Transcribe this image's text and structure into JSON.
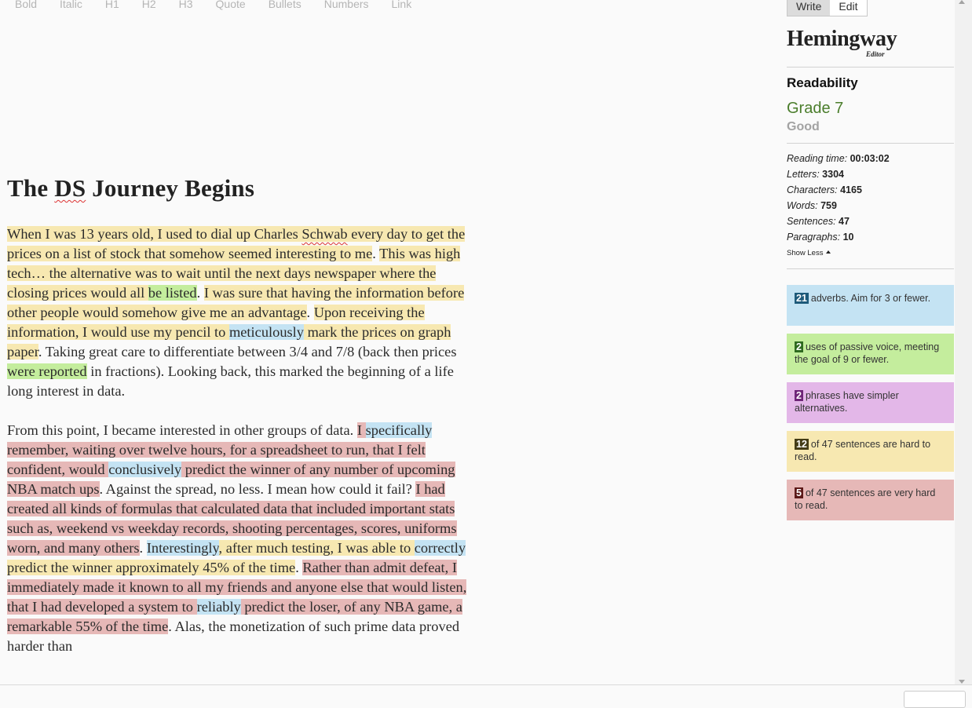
{
  "toolbar": {
    "bold": "Bold",
    "italic": "Italic",
    "h1": "H1",
    "h2": "H2",
    "h3": "H3",
    "quote": "Quote",
    "bullets": "Bullets",
    "numbers": "Numbers",
    "link": "Link"
  },
  "mode": {
    "write": "Write",
    "edit": "Edit",
    "active": "write"
  },
  "logo": {
    "name": "Hemingway",
    "sub": "Editor"
  },
  "readability": {
    "heading": "Readability",
    "grade": "Grade 7",
    "grade_desc": "Good"
  },
  "stats": {
    "reading_time_label": "Reading time:",
    "reading_time": "00:03:02",
    "letters_label": "Letters:",
    "letters": "3304",
    "characters_label": "Characters:",
    "characters": "4165",
    "words_label": "Words:",
    "words": "759",
    "sentences_label": "Sentences:",
    "sentences": "47",
    "paragraphs_label": "Paragraphs:",
    "paragraphs": "10",
    "show_less": "Show Less"
  },
  "cards": {
    "adverbs_count": "21",
    "adverbs_text": "adverbs. Aim for 3 or fewer.",
    "passive_count": "2",
    "passive_text": "uses of passive voice, meeting the goal of 9 or fewer.",
    "simpler_count": "2",
    "simpler_text": "phrases have simpler alternatives.",
    "hard_count": "12",
    "hard_text": "of 47 sentences are hard to read.",
    "very_hard_count": "5",
    "very_hard_text": "of 47 sentences are very hard to read."
  },
  "colors": {
    "hard_sentence": "#f7e8b1",
    "very_hard_sentence": "#e6b8b7",
    "adverb": "#c4e3f3",
    "passive": "#c4ed9d",
    "simpler": "#e3b7e8",
    "grade": "#4a7d2b"
  },
  "document": {
    "title_pre": "The ",
    "title_ds": "DS",
    "title_post": " Journey Begins",
    "p1": [
      {
        "t": "When I was 13 years old, I used to dial up Charles ",
        "h": "hy"
      },
      {
        "t": "Schwab",
        "h": "hy",
        "spell": true
      },
      {
        "t": " every day to get the prices on a list of stock that somehow seemed interesting to me",
        "h": "hy"
      },
      {
        "t": ". ",
        "h": ""
      },
      {
        "t": "This was high tech… the alternative was to wait until the next days newspaper where the closing prices would all ",
        "h": "hy"
      },
      {
        "t": "be listed",
        "h": "hg"
      },
      {
        "t": ". ",
        "h": ""
      },
      {
        "t": "I was sure that having the information before other people would somehow give me an advantage",
        "h": "hy"
      },
      {
        "t": ". ",
        "h": ""
      },
      {
        "t": "Upon receiving the information, I would use my pencil to ",
        "h": "hy"
      },
      {
        "t": "meticulously",
        "h": "hb"
      },
      {
        "t": " mark the prices on graph paper",
        "h": "hy"
      },
      {
        "t": ". Taking great care to differentiate between 3/4 and 7/8 (back then prices ",
        "h": ""
      },
      {
        "t": "were reported",
        "h": "hg"
      },
      {
        "t": " in fractions). Looking back, this marked the beginning of a life long interest in data.",
        "h": ""
      }
    ],
    "p2": [
      {
        "t": "From this point, I became interested in other groups of data. ",
        "h": ""
      },
      {
        "t": "I ",
        "h": "hr"
      },
      {
        "t": "specifically",
        "h": "hb"
      },
      {
        "t": " remember, waiting over twelve hours, for a spreadsheet to run, that I felt confident, would ",
        "h": "hr"
      },
      {
        "t": "conclusively",
        "h": "hb"
      },
      {
        "t": " predict the winner of any number of upcoming NBA match ups",
        "h": "hr"
      },
      {
        "t": ". Against the spread, no less. I mean how could it fail? ",
        "h": ""
      },
      {
        "t": "I had created all kinds of formulas that calculated data that included important stats such as, weekend vs weekday records, shooting percentages, scores, uniforms worn, and many others",
        "h": "hr"
      },
      {
        "t": ". ",
        "h": ""
      },
      {
        "t": "Interestingly",
        "h": "hb"
      },
      {
        "t": ", after much testing, I was able to ",
        "h": "hy"
      },
      {
        "t": "correctly",
        "h": "hb"
      },
      {
        "t": " predict the winner approximately 45% of the time",
        "h": "hy"
      },
      {
        "t": ". ",
        "h": ""
      },
      {
        "t": "Rather than admit defeat, I immediately made it known to all my friends and anyone else that would listen, that I had developed a system to ",
        "h": "hr"
      },
      {
        "t": "reliably",
        "h": "hb"
      },
      {
        "t": " predict the loser, of any NBA game, a remarkable 55% of the time",
        "h": "hr"
      },
      {
        "t": ". Alas, the monetization of such prime data proved harder than",
        "h": ""
      }
    ]
  }
}
